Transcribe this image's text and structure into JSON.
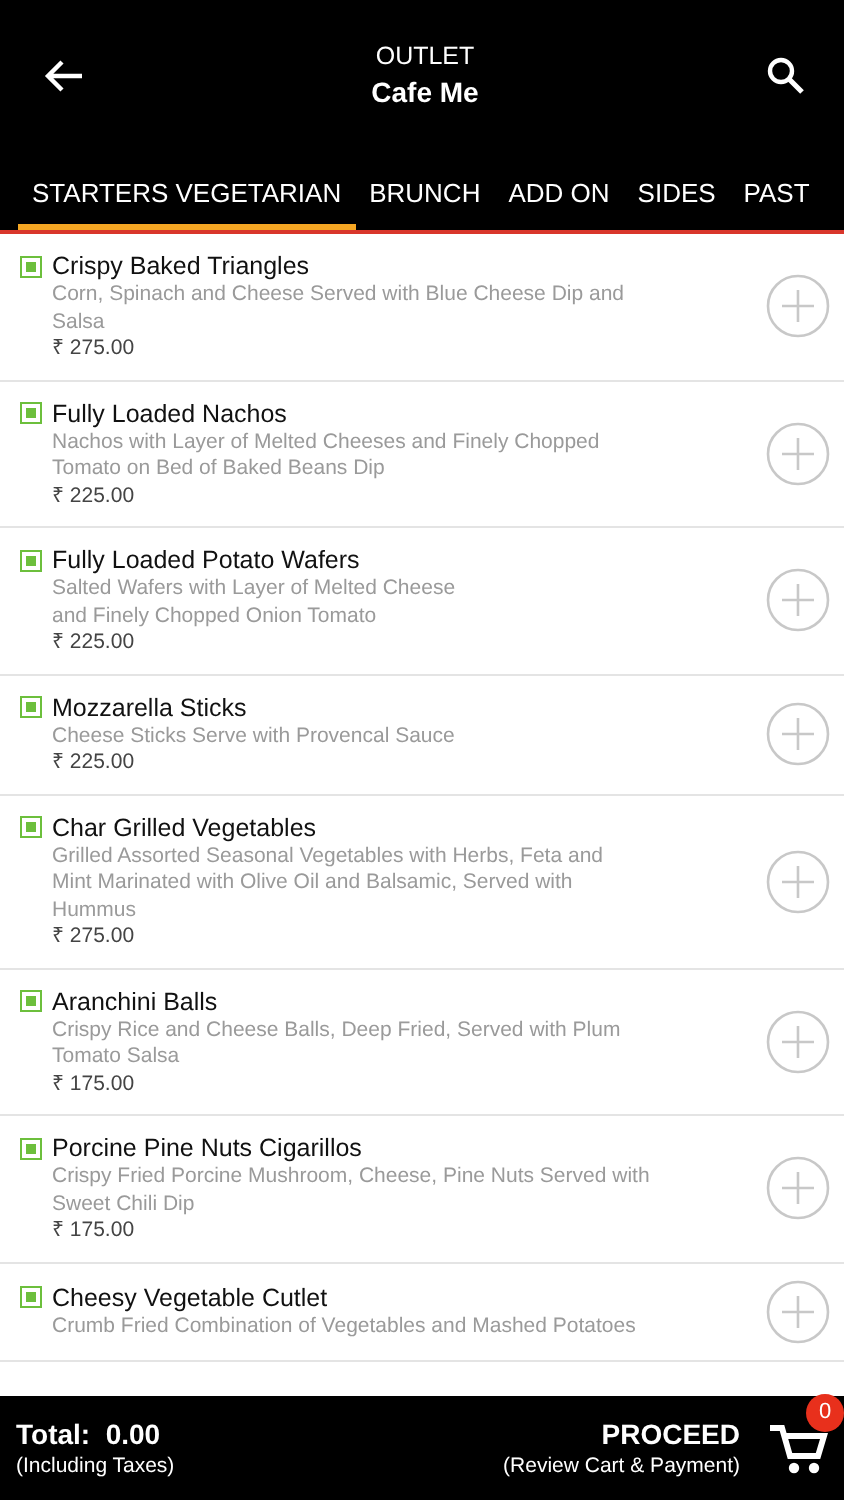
{
  "header": {
    "subtitle": "OUTLET",
    "title": "Cafe Me"
  },
  "tabs": [
    {
      "label": "STARTERS VEGETARIAN",
      "selected": true
    },
    {
      "label": "BRUNCH",
      "selected": false
    },
    {
      "label": "ADD ON",
      "selected": false
    },
    {
      "label": "SIDES",
      "selected": false
    },
    {
      "label": "PAST",
      "selected": false
    }
  ],
  "items": [
    {
      "name": "Crispy Baked Triangles",
      "description": [
        "Corn, Spinach and Cheese Served with Blue Cheese Dip and",
        "Salsa"
      ],
      "price": "₹ 275.00"
    },
    {
      "name": "Fully Loaded Nachos",
      "description": [
        "Nachos with Layer of Melted Cheeses and Finely Chopped",
        "Tomato on Bed of Baked Beans Dip"
      ],
      "price": "₹ 225.00"
    },
    {
      "name": "Fully Loaded Potato Wafers",
      "description": [
        "Salted Wafers with Layer of Melted Cheese",
        "and Finely Chopped Onion Tomato"
      ],
      "price": "₹ 225.00"
    },
    {
      "name": "Mozzarella Sticks",
      "description": [
        "Cheese Sticks Serve with Provencal Sauce"
      ],
      "price": "₹ 225.00"
    },
    {
      "name": "Char Grilled Vegetables",
      "description": [
        "Grilled Assorted Seasonal Vegetables with Herbs, Feta and",
        "Mint Marinated with Olive Oil and Balsamic, Served with",
        "Hummus"
      ],
      "price": "₹ 275.00"
    },
    {
      "name": "Aranchini Balls",
      "description": [
        "Crispy Rice and Cheese Balls, Deep Fried, Served with Plum",
        "Tomato Salsa"
      ],
      "price": "₹ 175.00"
    },
    {
      "name": "Porcine Pine Nuts Cigarillos",
      "description": [
        "Crispy Fried Porcine Mushroom, Cheese, Pine Nuts Served with",
        "Sweet Chili Dip"
      ],
      "price": "₹ 175.00"
    },
    {
      "name": "Cheesy Vegetable Cutlet",
      "description": [
        "Crumb Fried Combination of Vegetables and Mashed Potatoes"
      ]
    }
  ],
  "footer": {
    "total_label": "Total:",
    "total": "0.00",
    "total_note": "(Including Taxes)",
    "proceed": "PROCEED",
    "proceed_note": "(Review Cart & Payment)",
    "cart_count": "0"
  }
}
